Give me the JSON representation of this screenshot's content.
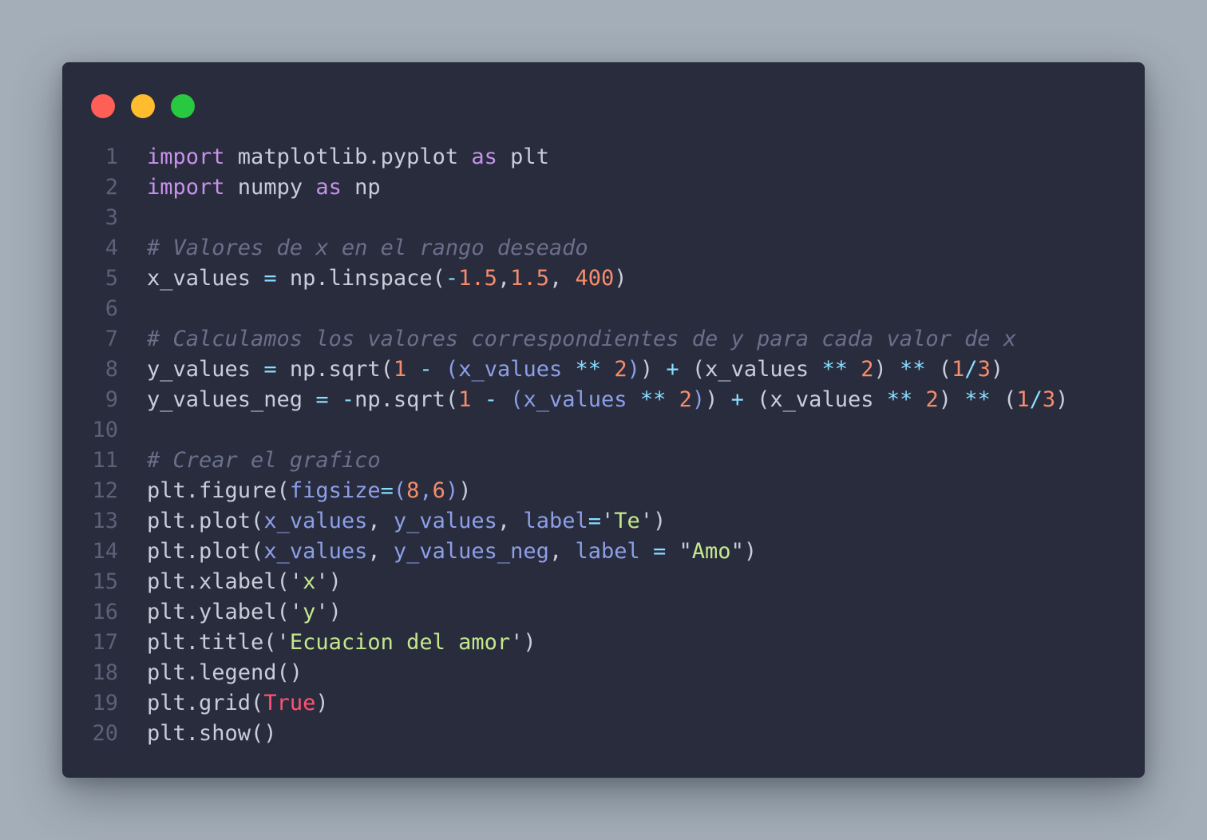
{
  "window": {
    "buttons": [
      "close",
      "minimize",
      "maximize"
    ]
  },
  "code": {
    "language": "python",
    "lines": [
      {
        "n": "1",
        "tokens": [
          [
            "kw",
            "import"
          ],
          [
            "t",
            " matplotlib.pyplot "
          ],
          [
            "kw",
            "as"
          ],
          [
            "t",
            " plt"
          ]
        ]
      },
      {
        "n": "2",
        "tokens": [
          [
            "kw",
            "import"
          ],
          [
            "t",
            " numpy "
          ],
          [
            "kw",
            "as"
          ],
          [
            "t",
            " np"
          ]
        ]
      },
      {
        "n": "3",
        "tokens": []
      },
      {
        "n": "4",
        "tokens": [
          [
            "cm",
            "# Valores de x en el rango deseado"
          ]
        ]
      },
      {
        "n": "5",
        "tokens": [
          [
            "t",
            "x_values "
          ],
          [
            "op",
            "="
          ],
          [
            "t",
            " np.linspace("
          ],
          [
            "op",
            "-"
          ],
          [
            "num",
            "1.5"
          ],
          [
            "t",
            ","
          ],
          [
            "num",
            "1.5"
          ],
          [
            "t",
            ", "
          ],
          [
            "num",
            "400"
          ],
          [
            "t",
            ")"
          ]
        ]
      },
      {
        "n": "6",
        "tokens": []
      },
      {
        "n": "7",
        "tokens": [
          [
            "cm",
            "# Calculamos los valores correspondientes de y para cada valor de x"
          ]
        ]
      },
      {
        "n": "8",
        "tokens": [
          [
            "t",
            "y_values "
          ],
          [
            "op",
            "="
          ],
          [
            "t",
            " np.sqrt("
          ],
          [
            "num",
            "1"
          ],
          [
            "t",
            " "
          ],
          [
            "op",
            "-"
          ],
          [
            "t",
            " "
          ],
          [
            "var",
            "(x_values"
          ],
          [
            "t",
            " "
          ],
          [
            "op",
            "**"
          ],
          [
            "t",
            " "
          ],
          [
            "num",
            "2"
          ],
          [
            "var",
            ")"
          ],
          [
            "t",
            ") "
          ],
          [
            "op",
            "+"
          ],
          [
            "t",
            " (x_values "
          ],
          [
            "op",
            "**"
          ],
          [
            "t",
            " "
          ],
          [
            "num",
            "2"
          ],
          [
            "t",
            ") "
          ],
          [
            "op",
            "**"
          ],
          [
            "t",
            " ("
          ],
          [
            "num",
            "1"
          ],
          [
            "op",
            "/"
          ],
          [
            "num",
            "3"
          ],
          [
            "t",
            ")"
          ]
        ]
      },
      {
        "n": "9",
        "tokens": [
          [
            "t",
            "y_values_neg "
          ],
          [
            "op",
            "="
          ],
          [
            "t",
            " "
          ],
          [
            "op",
            "-"
          ],
          [
            "t",
            "np.sqrt("
          ],
          [
            "num",
            "1"
          ],
          [
            "t",
            " "
          ],
          [
            "op",
            "-"
          ],
          [
            "t",
            " "
          ],
          [
            "var",
            "(x_values"
          ],
          [
            "t",
            " "
          ],
          [
            "op",
            "**"
          ],
          [
            "t",
            " "
          ],
          [
            "num",
            "2"
          ],
          [
            "var",
            ")"
          ],
          [
            "t",
            ") "
          ],
          [
            "op",
            "+"
          ],
          [
            "t",
            " (x_values "
          ],
          [
            "op",
            "**"
          ],
          [
            "t",
            " "
          ],
          [
            "num",
            "2"
          ],
          [
            "t",
            ") "
          ],
          [
            "op",
            "**"
          ],
          [
            "t",
            " ("
          ],
          [
            "num",
            "1"
          ],
          [
            "op",
            "/"
          ],
          [
            "num",
            "3"
          ],
          [
            "t",
            ")"
          ]
        ]
      },
      {
        "n": "10",
        "tokens": []
      },
      {
        "n": "11",
        "tokens": [
          [
            "cm",
            "# Crear el grafico"
          ]
        ]
      },
      {
        "n": "12",
        "tokens": [
          [
            "t",
            "plt.figure("
          ],
          [
            "var",
            "figsize"
          ],
          [
            "op",
            "="
          ],
          [
            "var",
            "("
          ],
          [
            "num",
            "8"
          ],
          [
            "var",
            ","
          ],
          [
            "num",
            "6"
          ],
          [
            "var",
            ")"
          ],
          [
            "t",
            ")"
          ]
        ]
      },
      {
        "n": "13",
        "tokens": [
          [
            "t",
            "plt.plot("
          ],
          [
            "var",
            "x_values"
          ],
          [
            "t",
            ", "
          ],
          [
            "var",
            "y_values"
          ],
          [
            "t",
            ", "
          ],
          [
            "var",
            "label"
          ],
          [
            "op",
            "="
          ],
          [
            "t",
            "'"
          ],
          [
            "str",
            "Te"
          ],
          [
            "t",
            "')"
          ]
        ]
      },
      {
        "n": "14",
        "tokens": [
          [
            "t",
            "plt.plot("
          ],
          [
            "var",
            "x_values"
          ],
          [
            "t",
            ", "
          ],
          [
            "var",
            "y_values_neg"
          ],
          [
            "t",
            ", "
          ],
          [
            "var",
            "label"
          ],
          [
            "t",
            " "
          ],
          [
            "op",
            "="
          ],
          [
            "t",
            " \""
          ],
          [
            "str",
            "Amo"
          ],
          [
            "t",
            "\")"
          ]
        ]
      },
      {
        "n": "15",
        "tokens": [
          [
            "t",
            "plt.xlabel('"
          ],
          [
            "str",
            "x"
          ],
          [
            "t",
            "')"
          ]
        ]
      },
      {
        "n": "16",
        "tokens": [
          [
            "t",
            "plt.ylabel('"
          ],
          [
            "str",
            "y"
          ],
          [
            "t",
            "')"
          ]
        ]
      },
      {
        "n": "17",
        "tokens": [
          [
            "t",
            "plt.title('"
          ],
          [
            "str",
            "Ecuacion del amor"
          ],
          [
            "t",
            "')"
          ]
        ]
      },
      {
        "n": "18",
        "tokens": [
          [
            "t",
            "plt.legend()"
          ]
        ]
      },
      {
        "n": "19",
        "tokens": [
          [
            "t",
            "plt.grid("
          ],
          [
            "bool",
            "True"
          ],
          [
            "t",
            ")"
          ]
        ]
      },
      {
        "n": "20",
        "tokens": [
          [
            "t",
            "plt.show()"
          ]
        ]
      }
    ]
  },
  "colors": {
    "background": "#a4aeb8",
    "window": "#292c3d",
    "close": "#ff5f57",
    "minimize": "#febc2e",
    "maximize": "#28c840",
    "keyword": "#c792ea",
    "comment": "#69708a",
    "number": "#f78c6c",
    "string": "#c3e88d",
    "operator": "#89ddff",
    "param": "#8c9fe8",
    "boolean": "#ff5370",
    "text": "#c8ced9",
    "line_number": "#5b6177"
  }
}
